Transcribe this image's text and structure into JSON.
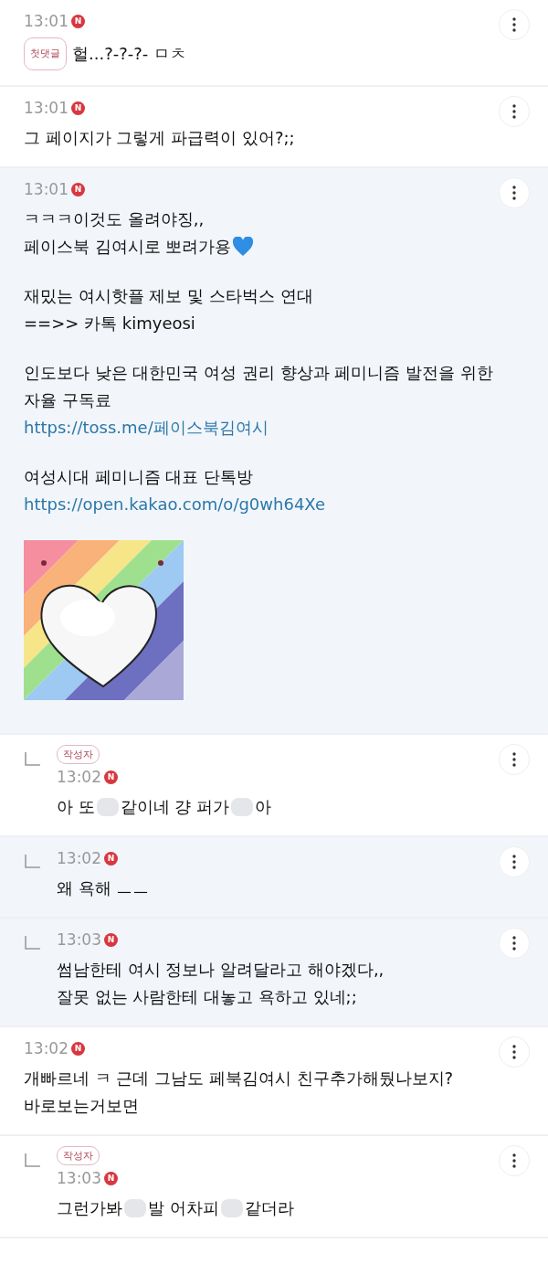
{
  "comments": [
    {
      "reply": false,
      "highlighted": false,
      "badge": "첫댓글",
      "badge_inline": true,
      "time": "13:01",
      "is_new": true,
      "new_mark": "N",
      "paragraphs": [
        [
          [
            {
              "kind": "text",
              "text": "헐...?-?-?- ㅁㅊ"
            }
          ]
        ]
      ]
    },
    {
      "reply": false,
      "highlighted": false,
      "time": "13:01",
      "is_new": true,
      "new_mark": "N",
      "paragraphs": [
        [
          [
            {
              "kind": "text",
              "text": "그 페이지가 그렇게 파급력이 있어?;;"
            }
          ]
        ]
      ]
    },
    {
      "reply": false,
      "highlighted": true,
      "time": "13:01",
      "is_new": true,
      "new_mark": "N",
      "paragraphs": [
        [
          [
            {
              "kind": "text",
              "text": "ㅋㅋㅋ이것도 올려야징,,"
            }
          ],
          [
            {
              "kind": "text",
              "text": "페이스북 김여시로 뽀려가용"
            },
            {
              "kind": "heart"
            }
          ]
        ],
        [
          [
            {
              "kind": "text",
              "text": "재밌는 여시핫플 제보 및 스타벅스 연대"
            }
          ],
          [
            {
              "kind": "text",
              "text": "==>> 카톡 kimyeosi"
            }
          ]
        ],
        [
          [
            {
              "kind": "text",
              "text": "인도보다 낮은 대한민국 여성 권리 향상과 페미니즘 발전을 위한"
            }
          ],
          [
            {
              "kind": "text",
              "text": "자율 구독료"
            }
          ],
          [
            {
              "kind": "link",
              "text": "https://toss.me/페이스북김여시"
            }
          ]
        ],
        [
          [
            {
              "kind": "text",
              "text": "여성시대 페미니즘 대표 단톡방"
            }
          ],
          [
            {
              "kind": "link",
              "text": "https://open.kakao.com/o/g0wh64Xe"
            }
          ]
        ]
      ],
      "image": {
        "kind": "picture"
      }
    },
    {
      "reply": true,
      "highlighted": false,
      "badge": "작성자",
      "badge_inline": false,
      "time": "13:02",
      "is_new": true,
      "new_mark": "N",
      "paragraphs": [
        [
          [
            {
              "kind": "text",
              "text": "아 또"
            },
            {
              "kind": "blur"
            },
            {
              "kind": "text",
              "text": "같이네 걍 퍼가"
            },
            {
              "kind": "blur"
            },
            {
              "kind": "text",
              "text": "아"
            }
          ]
        ]
      ]
    },
    {
      "reply": true,
      "highlighted": true,
      "time": "13:02",
      "is_new": true,
      "new_mark": "N",
      "paragraphs": [
        [
          [
            {
              "kind": "text",
              "text": "왜 욕해 ㅡㅡ"
            }
          ]
        ]
      ]
    },
    {
      "reply": true,
      "highlighted": true,
      "time": "13:03",
      "is_new": true,
      "new_mark": "N",
      "paragraphs": [
        [
          [
            {
              "kind": "text",
              "text": "썸남한테 여시 정보나 알려달라고 해야겠다,,"
            }
          ],
          [
            {
              "kind": "text",
              "text": "잘못 없는 사람한테 대놓고 욕하고 있네;;"
            }
          ]
        ]
      ]
    },
    {
      "reply": false,
      "highlighted": false,
      "time": "13:02",
      "is_new": true,
      "new_mark": "N",
      "paragraphs": [
        [
          [
            {
              "kind": "text",
              "text": "개빠르네 ㅋ 근데 그남도 페북김여시 친구추가해뒀나보지?"
            }
          ],
          [
            {
              "kind": "text",
              "text": "바로보는거보면"
            }
          ]
        ]
      ]
    },
    {
      "reply": true,
      "highlighted": false,
      "badge": "작성자",
      "badge_inline": false,
      "time": "13:03",
      "is_new": true,
      "new_mark": "N",
      "paragraphs": [
        [
          [
            {
              "kind": "text",
              "text": "그런가봐"
            },
            {
              "kind": "blur"
            },
            {
              "kind": "text",
              "text": "발 어차피"
            },
            {
              "kind": "blur"
            },
            {
              "kind": "text",
              "text": "같더라"
            }
          ]
        ]
      ]
    }
  ]
}
